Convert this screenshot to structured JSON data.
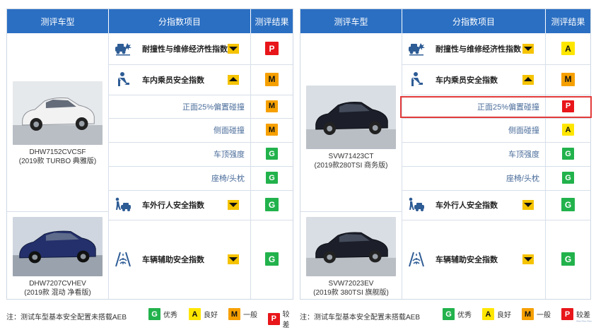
{
  "left": {
    "headers": {
      "model": "测评车型",
      "items": "分指数项目",
      "result": "测评结果"
    },
    "cars": [
      {
        "model": "DHW7152CVCSF",
        "desc": "(2019款 TURBO 典雅版)"
      },
      {
        "model": "DHW7207CVHEV",
        "desc": "(2019款 混动 净看版)"
      }
    ],
    "rows": [
      {
        "label": "耐撞性与维修经济性指数",
        "grade": "P",
        "arrow": "down",
        "icon": "car-crash-icon"
      },
      {
        "label": "车内乘员安全指数",
        "grade": "M",
        "arrow": "up",
        "icon": "seated-occupant-icon"
      },
      {
        "label": "正面25%偏置碰撞",
        "grade": "M"
      },
      {
        "label": "侧面碰撞",
        "grade": "M"
      },
      {
        "label": "车顶强度",
        "grade": "G"
      },
      {
        "label": "座椅/头枕",
        "grade": "G"
      },
      {
        "label": "车外行人安全指数",
        "grade": "G",
        "arrow": "down",
        "icon": "pedestrian-car-icon"
      },
      {
        "label": "车辆辅助安全指数",
        "grade": "G",
        "arrow": "down",
        "icon": "lane-assist-icon"
      }
    ]
  },
  "right": {
    "headers": {
      "model": "测评车型",
      "items": "分指数项目",
      "result": "测评结果"
    },
    "cars": [
      {
        "model": "SVW71423CT",
        "desc": "(2019款280TSI 商务版)"
      },
      {
        "model": "SVW72023EV",
        "desc": "(2019款 380TSI 旗舰版)"
      }
    ],
    "rows": [
      {
        "label": "耐撞性与维修经济性指数",
        "grade": "A",
        "arrow": "down",
        "icon": "car-crash-icon"
      },
      {
        "label": "车内乘员安全指数",
        "grade": "M",
        "arrow": "up",
        "icon": "seated-occupant-icon"
      },
      {
        "label": "正面25%偏置碰撞",
        "grade": "P"
      },
      {
        "label": "侧面碰撞",
        "grade": "A"
      },
      {
        "label": "车顶强度",
        "grade": "G"
      },
      {
        "label": "座椅/头枕",
        "grade": "G"
      },
      {
        "label": "车外行人安全指数",
        "grade": "G",
        "arrow": "down",
        "icon": "pedestrian-car-icon"
      },
      {
        "label": "车辆辅助安全指数",
        "grade": "G",
        "arrow": "down",
        "icon": "lane-assist-icon"
      }
    ]
  },
  "legend": {
    "note": "注：测试车型基本安全配置未搭载AEB",
    "items": [
      {
        "grade": "G",
        "label": "优秀"
      },
      {
        "grade": "A",
        "label": "良好"
      },
      {
        "grade": "M",
        "label": "一般"
      },
      {
        "grade": "P",
        "label": "较差"
      }
    ]
  },
  "colors": {
    "header": "#2b6fc2",
    "G": "#22b24c",
    "A": "#ffe600",
    "M": "#f6a000",
    "P": "#e8161a",
    "arrow": "#f5c300",
    "highlight": "#e23a3a"
  }
}
